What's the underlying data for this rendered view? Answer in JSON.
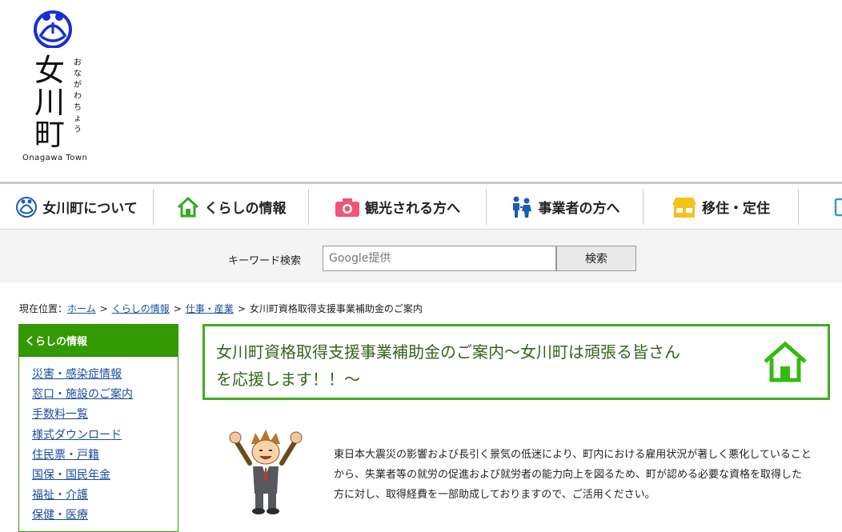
{
  "logo": {
    "kanji": [
      "女",
      "川",
      "町"
    ],
    "kana": [
      "お",
      "な",
      "が",
      "わ",
      "ち",
      "ょ",
      "う"
    ],
    "english": "Onagawa Town"
  },
  "nav": {
    "items": [
      {
        "label": "女川町について",
        "icon": "town-emblem-icon"
      },
      {
        "label": "くらしの情報",
        "icon": "house-icon"
      },
      {
        "label": "観光される方へ",
        "icon": "camera-icon"
      },
      {
        "label": "事業者の方へ",
        "icon": "people-icon"
      },
      {
        "label": "移住・定住",
        "icon": "shop-icon"
      }
    ]
  },
  "search": {
    "label": "キーワード検索",
    "placeholder": "Google提供",
    "button": "検索"
  },
  "breadcrumb": {
    "prefix": "現在位置：",
    "links": [
      "ホーム",
      "くらしの情報",
      "仕事・産業"
    ],
    "current": "女川町資格取得支援事業補助金のご案内"
  },
  "sidebar": {
    "title": "くらしの情報",
    "items": [
      "災害・感染症情報",
      "窓口・施設のご案内",
      "手数料一覧",
      "様式ダウンロード",
      "住民票・戸籍",
      "国保・国民年金",
      "福祉・介護",
      "保健・医療"
    ]
  },
  "page": {
    "title_line1": "女川町資格取得支援事業補助金のご案内～女川町は頑張る皆さん",
    "title_line2": "を応援します！！～",
    "body_line1": "東日本大震災の影響および長引く景気の低迷により、町内における雇用状況が著しく悪化していること",
    "body_line2": "から、失業者等の就労の促進および就労者の能力向上を図るため、町が認める必要な資格を取得した",
    "body_line3": "方に対し、取得経費を一部助成しておりますので、ご活用ください。"
  },
  "colors": {
    "green": "#339900",
    "title_border": "#44aa22",
    "title_text": "#33661a",
    "link": "#1a4e9a",
    "logo_blue": "#1a2fd0"
  }
}
